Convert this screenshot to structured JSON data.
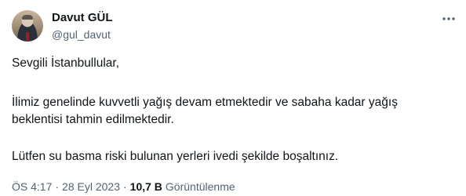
{
  "author": {
    "name": "Davut GÜL",
    "handle": "@gul_davut",
    "avatar_icon": "profile-photo-avatar"
  },
  "more_icon": "more-horizontal-icon",
  "tweet": {
    "paragraph_1": "Sevgili İstanbullular,",
    "paragraph_2_line_1": "İlimiz genelinde kuvvetli yağış devam etmektedir ve sabaha kadar yağış",
    "paragraph_2_line_2": "beklentisi tahmin edilmektedir.",
    "paragraph_3": "Lütfen su basma riski bulunan yerleri ivedi şekilde boşaltınız."
  },
  "meta": {
    "time": "ÖS 4:17",
    "separator": "·",
    "date": "28 Eyl 2023",
    "views_count": "10,7 B",
    "views_label": "Görüntülenme"
  },
  "colors": {
    "text_primary": "#0f1419",
    "text_secondary": "#536471",
    "background": "#ffffff"
  }
}
